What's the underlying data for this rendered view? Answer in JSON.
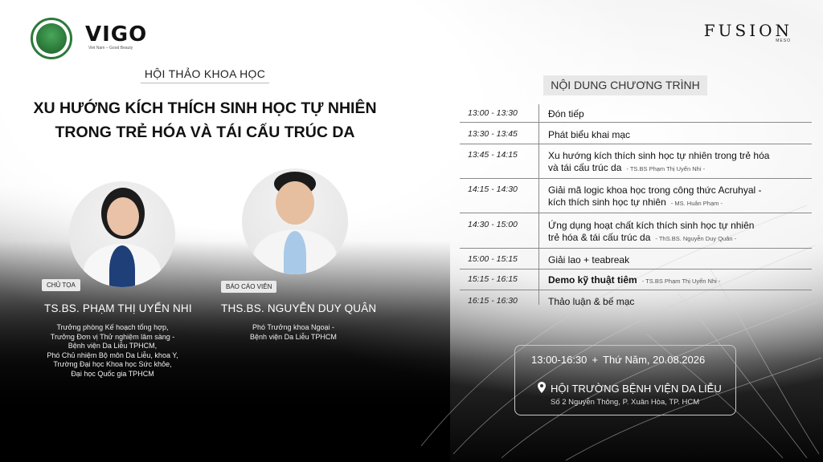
{
  "logos": {
    "vigo": "VIGO",
    "vigo_tagline": "Viet Nam – Good Beauty",
    "fusion": "FUSION",
    "fusion_sub": "MESO"
  },
  "header": {
    "event_type": "HỘI THẢO KHOA HỌC",
    "title_line1": "XU HƯỚNG KÍCH THÍCH SINH HỌC TỰ NHIÊN",
    "title_line2": "TRONG TRẺ HÓA VÀ TÁI CẤU TRÚC DA"
  },
  "speakers": [
    {
      "role": "CHỦ TỌA",
      "name": "TS.BS. PHẠM THỊ UYỂN NHI",
      "description_lines": [
        "Trưởng phòng Kế hoạch tổng hợp,",
        "Trưởng Đơn vị Thử nghiệm lâm sàng -",
        "Bệnh viện Da Liễu TPHCM,",
        "Phó Chủ nhiệm Bộ môn Da Liễu, khoa Y,",
        "Trường Đại học Khoa học Sức khỏe,",
        "Đại học Quốc gia TPHCM"
      ]
    },
    {
      "role": "BÁO CÁO VIÊN",
      "name": "THS.BS. NGUYỄN DUY QUÂN",
      "description_lines": [
        "Phó Trưởng khoa Ngoại -",
        "Bệnh viện Da Liễu TPHCM"
      ]
    }
  ],
  "program": {
    "title": "NỘI DUNG CHƯƠNG TRÌNH",
    "rows": [
      {
        "time": "13:00 - 13:30",
        "desc_lines": [
          "Đón tiếp"
        ],
        "speaker": ""
      },
      {
        "time": "13:30 - 13:45",
        "desc_lines": [
          "Phát biểu khai mạc"
        ],
        "speaker": ""
      },
      {
        "time": "13:45 - 14:15",
        "desc_lines": [
          "Xu hướng kích thích sinh học tự nhiên trong trẻ hóa",
          "và tái cấu trúc da"
        ],
        "speaker": "- TS.BS Phạm Thị Uyển Nhi -"
      },
      {
        "time": "14:15 - 14:30",
        "desc_lines": [
          "Giải mã logic khoa học trong công thức Acruhyal -",
          "kích thích sinh học tự nhiên"
        ],
        "speaker": "- MS. Huân Phạm -"
      },
      {
        "time": "14:30 - 15:00",
        "desc_lines": [
          "Ứng dụng hoạt chất kích thích sinh học tự nhiên",
          "trẻ hóa & tái cấu trúc da"
        ],
        "speaker": "- ThS.BS. Nguyễn Duy Quân -"
      },
      {
        "time": "15:00 - 15:15",
        "desc_lines": [
          "Giải lao + teabreak"
        ],
        "speaker": ""
      },
      {
        "time": "15:15 - 16:15",
        "desc_lines": [
          "Demo kỹ thuật tiêm"
        ],
        "speaker": "- TS.BS Phạm Thị Uyển Nhi -"
      },
      {
        "time": "16:15 - 16:30",
        "desc_lines": [
          "Thảo luận & bế mạc"
        ],
        "speaker": ""
      }
    ]
  },
  "info": {
    "time": "13:00-16:30",
    "plus": "+",
    "date": "Thứ Năm, 20.08.2026",
    "venue": "HỘI TRƯỜNG BỆNH VIỆN DA LIỄU",
    "address": "Số 2 Nguyễn Thông, P. Xuân Hòa, TP. HCM"
  }
}
